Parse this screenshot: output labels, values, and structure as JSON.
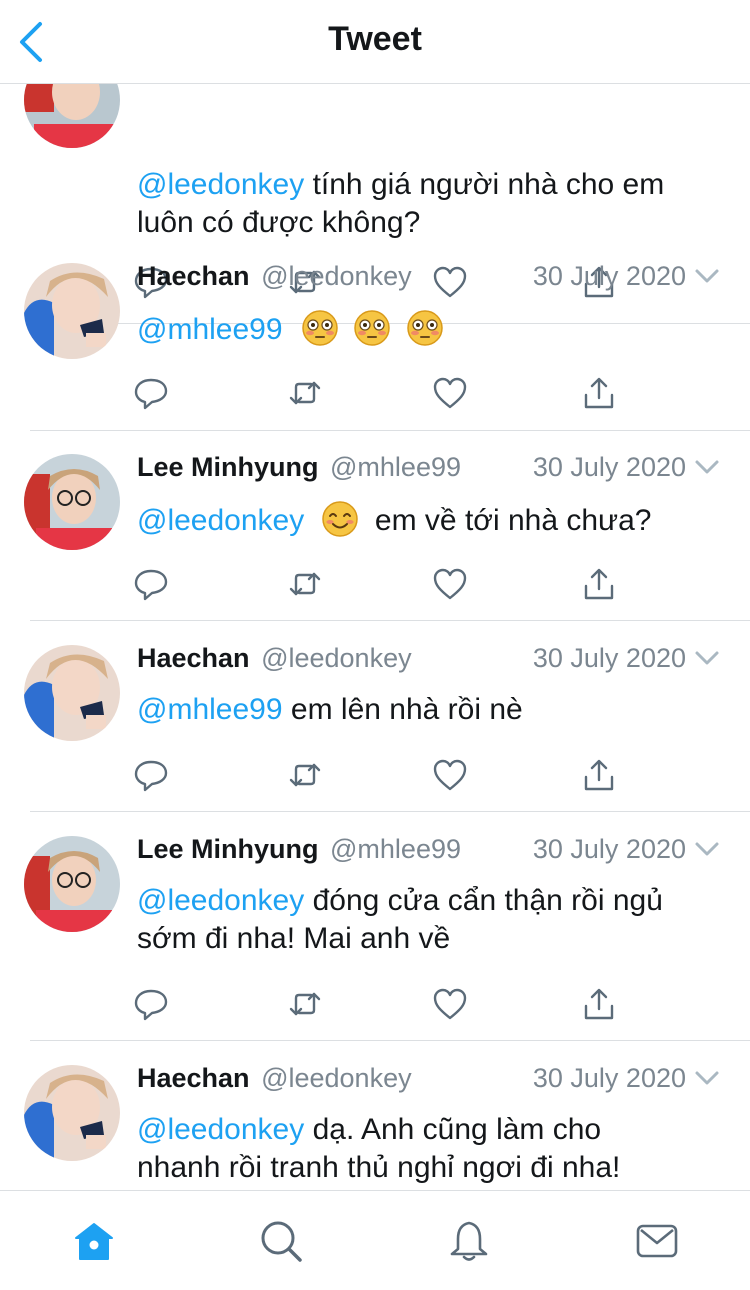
{
  "header": {
    "title": "Tweet"
  },
  "tweets": [
    {
      "name": "",
      "handle": "",
      "date": "",
      "mention": "@leedonkey",
      "text": "tính giá người nhà cho em",
      "text2": "luôn có được không?"
    },
    {
      "name": "Haechan",
      "handle": "@leedonkey",
      "date": "30 July 2020",
      "mention": "@mhlee99",
      "text": "",
      "emojis": [
        "flushed-face",
        "flushed-face",
        "flushed-face"
      ]
    },
    {
      "name": "Lee Minhyung",
      "handle": "@mhlee99",
      "date": "30 July 2020",
      "mention": "@leedonkey",
      "text": "em về tới nhà chưa?",
      "emojis": [
        "smiling-face"
      ]
    },
    {
      "name": "Haechan",
      "handle": "@leedonkey",
      "date": "30 July 2020",
      "mention": "@mhlee99",
      "text": "em lên nhà rồi nè"
    },
    {
      "name": "Lee Minhyung",
      "handle": "@mhlee99",
      "date": "30 July 2020",
      "mention": "@leedonkey",
      "text": "đóng cửa cẩn thận rồi ngủ",
      "text2": "sớm đi nha! Mai anh về"
    },
    {
      "name": "Haechan",
      "handle": "@leedonkey",
      "date": "30 July 2020",
      "mention": "@leedonkey",
      "text": "dạ. Anh cũng làm cho",
      "text2": "nhanh rồi tranh thủ nghỉ ngơi đi nha!"
    }
  ],
  "icons": {
    "back": "chevron-left-icon",
    "reply": "reply-icon",
    "retweet": "retweet-icon",
    "like": "heart-icon",
    "share": "share-icon",
    "more": "chevron-down-icon",
    "tabs": [
      "home-icon",
      "search-icon",
      "notifications-icon",
      "messages-icon"
    ]
  },
  "colors": {
    "accent": "#1da1f2",
    "text": "#14171a",
    "muted": "#7b8690",
    "divider": "#dcdfe2",
    "icon": "#5b6b79"
  }
}
